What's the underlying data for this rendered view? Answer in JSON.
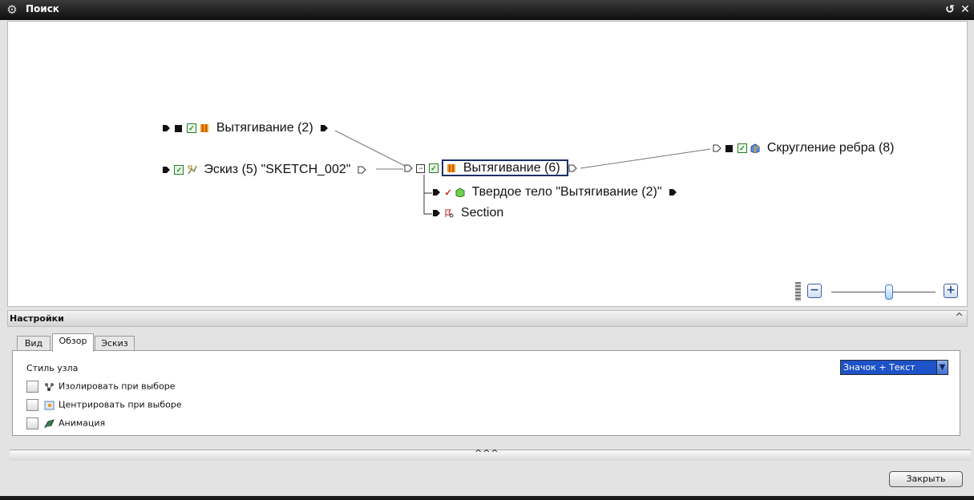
{
  "window": {
    "title": "Поиск"
  },
  "graph": {
    "nodes": [
      {
        "id": "n1",
        "label": "Вытягивание (2)"
      },
      {
        "id": "n2",
        "label": "Эскиз (5) \"SKETCH_002\""
      },
      {
        "id": "n3",
        "label": "Вытягивание (6)",
        "selected": true
      },
      {
        "id": "n4",
        "label": "Твердое тело \"Вытягивание (2)\""
      },
      {
        "id": "n5",
        "label": "Section"
      },
      {
        "id": "n6",
        "label": "Скругление ребра (8)"
      }
    ],
    "edges": [
      [
        "n1",
        "n3"
      ],
      [
        "n2",
        "n3"
      ],
      [
        "n3",
        "n6"
      ],
      [
        "n3",
        "n4"
      ],
      [
        "n3",
        "n5"
      ]
    ]
  },
  "zoom": {
    "minus": "−",
    "plus": "+",
    "level": 0.55
  },
  "settings": {
    "header": "Настройки",
    "collapse_glyph": "^",
    "tabs": [
      {
        "label": "Вид",
        "active": false
      },
      {
        "label": "Обзор",
        "active": true
      },
      {
        "label": "Эскиз",
        "active": false
      }
    ],
    "node_style_label": "Стиль узла",
    "node_style_value": "Значок + Текст",
    "options": [
      {
        "label": "Изолировать при выборе",
        "checked": false,
        "icon": "isolate-icon"
      },
      {
        "label": "Центрировать при выборе",
        "checked": false,
        "icon": "center-icon"
      },
      {
        "label": "Анимация",
        "checked": false,
        "icon": "animation-icon"
      }
    ]
  },
  "splitter": {
    "glyph": "^^^"
  },
  "footer": {
    "close_label": "Закрыть"
  },
  "colors": {
    "titlebar": "#1a1a1a",
    "selection_border": "#1c2f6a",
    "dropdown_bg": "#1d52c8"
  }
}
